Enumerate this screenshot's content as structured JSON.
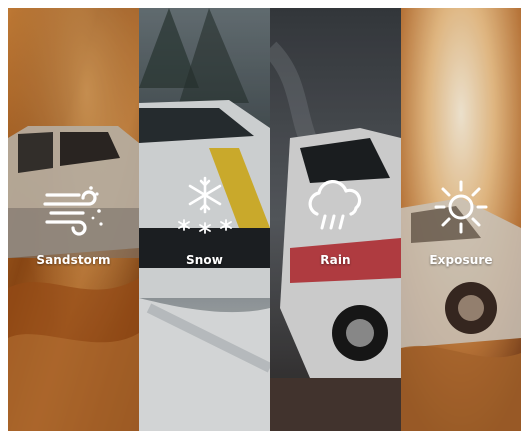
{
  "tiles": [
    {
      "label": "Sandstorm",
      "icon": "wind-dust-icon"
    },
    {
      "label": "Snow",
      "icon": "snowflake-icon"
    },
    {
      "label": "Rain",
      "icon": "cloud-rain-icon"
    },
    {
      "label": "Exposure",
      "icon": "sun-icon"
    }
  ],
  "colors": {
    "sandstorm": "#b4651f",
    "snow": "#9aa3a8",
    "rain": "#4a4f55",
    "exposure": "#d79a5a",
    "label": "#ffffff"
  }
}
